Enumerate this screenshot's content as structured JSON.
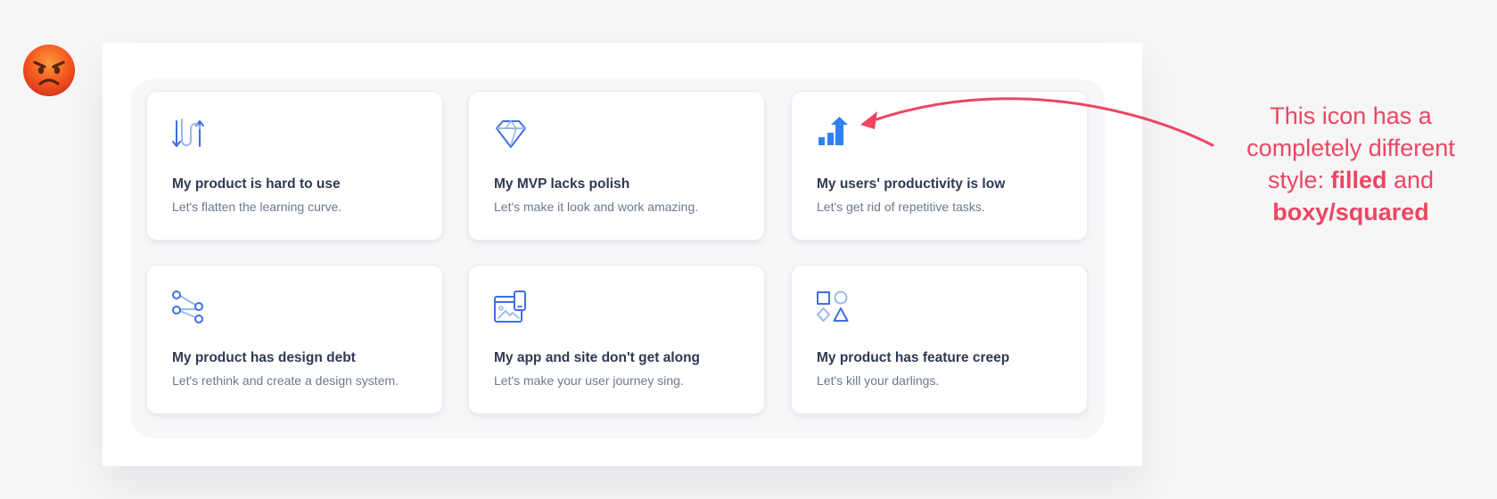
{
  "emoji": {
    "name": "angry-face-emoji"
  },
  "cards": [
    {
      "icon": "arrows-swap-icon",
      "title": "My product is hard to use",
      "desc": "Let's flatten the learning curve."
    },
    {
      "icon": "diamond-icon",
      "title": "My MVP lacks polish",
      "desc": "Let's make it look and work amazing."
    },
    {
      "icon": "bar-chart-up-arrow-icon",
      "title": "My users' productivity is low",
      "desc": "Let's get rid of repetitive tasks."
    },
    {
      "icon": "nodes-share-icon",
      "title": "My product has design debt",
      "desc": "Let's rethink and create a design system."
    },
    {
      "icon": "devices-image-icon",
      "title": "My app and site don't get along",
      "desc": "Let's make your user journey sing."
    },
    {
      "icon": "shapes-icon",
      "title": "My product has feature creep",
      "desc": "Let's kill your darlings."
    }
  ],
  "annotation": {
    "line1": "This icon has a",
    "line2": "completely different",
    "line3_prefix": "style: ",
    "bold1": "filled",
    "and": " and",
    "bold2": "boxy/squared"
  },
  "colors": {
    "accent": "#3f6fe0",
    "accent_light": "#9bb7f0",
    "filled_icon": "#2f80f5",
    "annotation": "#ec4661",
    "title_text": "#2f3a52",
    "desc_text": "#6c7891"
  }
}
